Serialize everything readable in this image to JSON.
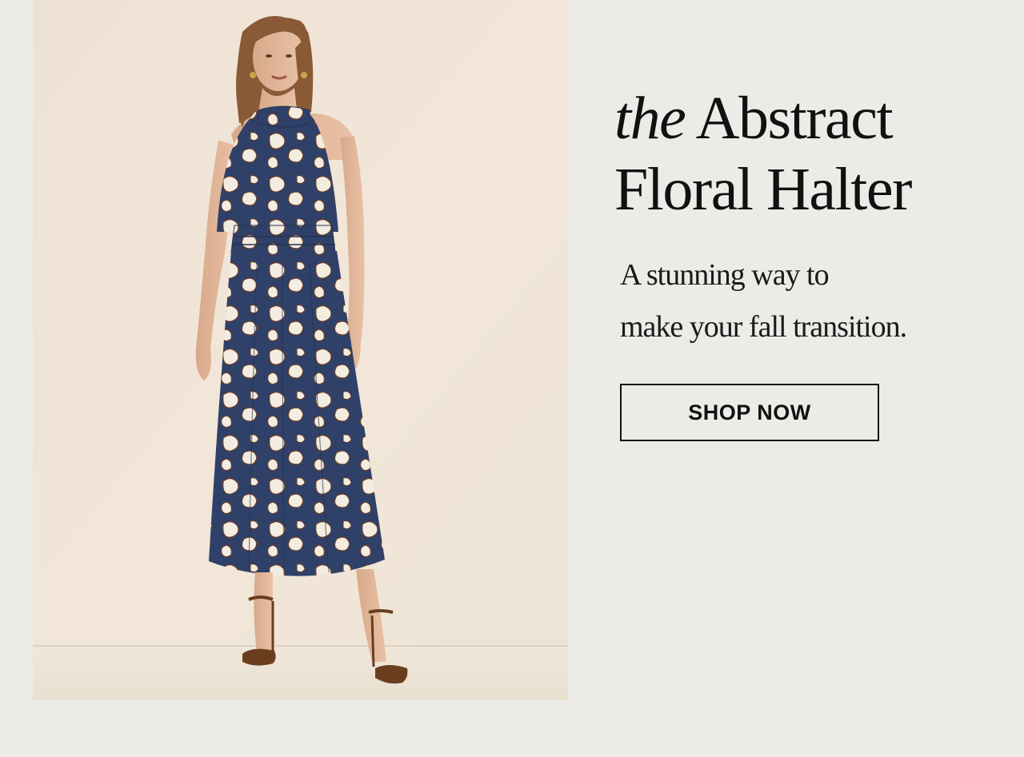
{
  "hero": {
    "headline_italic": "the",
    "headline_rest": "Abstract",
    "headline_line2": "Floral Halter",
    "subcopy_line1": "A stunning way to",
    "subcopy_line2": "make your fall transition.",
    "cta_label": "SHOP NOW"
  },
  "colors": {
    "page_background": "#edebe7",
    "text": "#111111",
    "dress_navy": "#2f4169",
    "dress_print": "#f2ece1"
  }
}
